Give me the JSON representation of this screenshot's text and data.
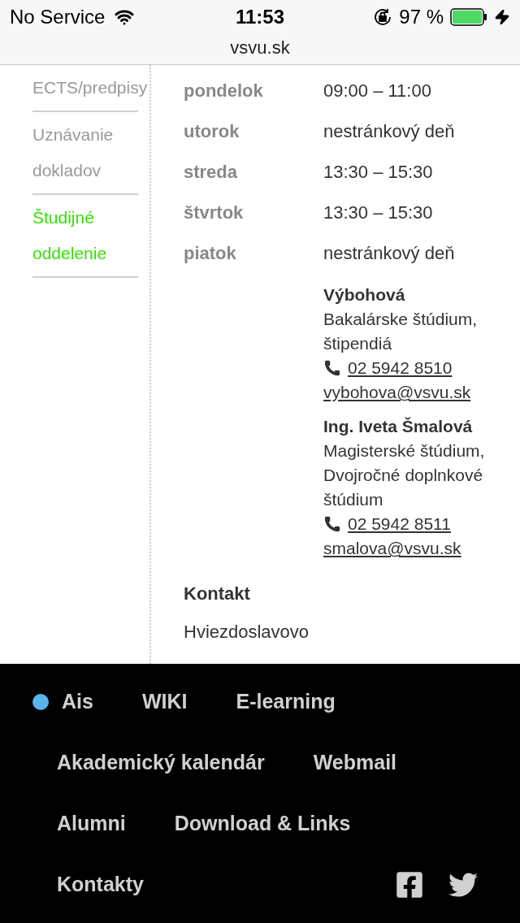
{
  "status_bar": {
    "carrier": "No Service",
    "time": "11:53",
    "battery": "97 %",
    "url": "vsvu.sk"
  },
  "sidebar": {
    "items": [
      {
        "label": "ECTS/predpisy",
        "selected": false
      },
      {
        "label": "Uznávanie dokladov",
        "selected": false
      },
      {
        "label": "Študijné oddelenie",
        "selected": true
      }
    ]
  },
  "office_hours": [
    {
      "day": "pondelok",
      "hours": "09:00 – 11:00"
    },
    {
      "day": "utorok",
      "hours": "nestránkový deň"
    },
    {
      "day": "streda",
      "hours": "13:30 – 15:30"
    },
    {
      "day": "štvrtok",
      "hours": "13:30 – 15:30"
    },
    {
      "day": "piatok",
      "hours": "nestránkový deň"
    }
  ],
  "contacts": [
    {
      "name": "Výbohová",
      "role": "Bakalárske štúdium, štipendiá",
      "phone": "02 5942 8510",
      "email": "vybohova@vsvu.sk"
    },
    {
      "name": "Ing. Iveta Šmalová",
      "role": "Magisterské štúdium, Dvojročné doplnkové štúdium",
      "phone": "02 5942 8511",
      "email": "smalova@vsvu.sk"
    }
  ],
  "contact_heading": "Kontakt",
  "address": "Hviezdoslavovo",
  "footer": {
    "rows": [
      [
        {
          "label": "Ais",
          "selected": true
        },
        {
          "label": "WIKI",
          "selected": false
        },
        {
          "label": "E-learning",
          "selected": false
        }
      ],
      [
        {
          "label": "Akademický kalendár",
          "selected": false
        },
        {
          "label": "Webmail",
          "selected": false
        }
      ],
      [
        {
          "label": "Alumni",
          "selected": false
        },
        {
          "label": "Download & Links",
          "selected": false
        }
      ],
      [
        {
          "label": "Kontakty",
          "selected": false
        }
      ]
    ]
  }
}
